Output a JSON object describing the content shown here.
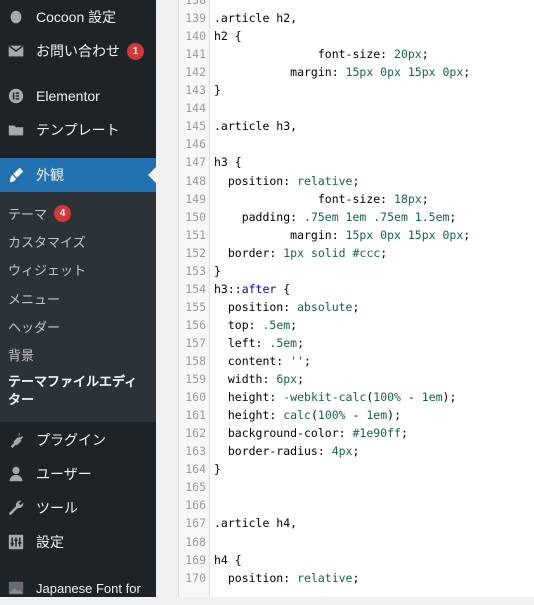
{
  "sidebar": {
    "items": [
      {
        "label": "Cocoon 設定",
        "icon": "circle-icon"
      },
      {
        "label": "お問い合わせ",
        "icon": "envelope-icon",
        "badge": "1"
      },
      {
        "label": "Elementor",
        "icon": "elementor-icon"
      },
      {
        "label": "テンプレート",
        "icon": "folder-icon"
      },
      {
        "label": "外観",
        "icon": "paintbrush-icon",
        "active": true
      },
      {
        "label": "プラグイン",
        "icon": "plugin-icon"
      },
      {
        "label": "ユーザー",
        "icon": "user-icon"
      },
      {
        "label": "ツール",
        "icon": "wrench-icon"
      },
      {
        "label": "設定",
        "icon": "settings-icon"
      },
      {
        "label": "Japanese Font for",
        "icon": "image-icon"
      }
    ],
    "submenu": [
      {
        "label": "テーマ",
        "badge": "4"
      },
      {
        "label": "カスタマイズ"
      },
      {
        "label": "ウィジェット"
      },
      {
        "label": "メニュー"
      },
      {
        "label": "ヘッダー"
      },
      {
        "label": "背景"
      },
      {
        "label": "テーマファイルエディター",
        "current": true
      }
    ],
    "active_color": "#2271b1",
    "badge_color": "#d63638"
  },
  "editor": {
    "lines": [
      {
        "n": "138",
        "tokens": []
      },
      {
        "n": "139",
        "tokens": [
          {
            "t": ".article h2,",
            "c": "sel"
          }
        ]
      },
      {
        "n": "140",
        "tokens": [
          {
            "t": "h2 {",
            "c": "sel"
          }
        ]
      },
      {
        "n": "141",
        "tokens": [
          {
            "t": "               font-size: ",
            "c": "prop"
          },
          {
            "t": "20px",
            "c": "num"
          },
          {
            "t": ";",
            "c": "prop"
          }
        ]
      },
      {
        "n": "142",
        "tokens": [
          {
            "t": "           margin: ",
            "c": "prop"
          },
          {
            "t": "15px 0px 15px 0px",
            "c": "num"
          },
          {
            "t": ";",
            "c": "prop"
          }
        ]
      },
      {
        "n": "143",
        "tokens": [
          {
            "t": "}",
            "c": "sel"
          }
        ]
      },
      {
        "n": "144",
        "tokens": []
      },
      {
        "n": "145",
        "tokens": [
          {
            "t": ".article h3,",
            "c": "sel"
          }
        ]
      },
      {
        "n": "146",
        "tokens": []
      },
      {
        "n": "147",
        "tokens": [
          {
            "t": "h3 {",
            "c": "sel"
          }
        ]
      },
      {
        "n": "148",
        "tokens": [
          {
            "t": "  position: ",
            "c": "prop"
          },
          {
            "t": "relative",
            "c": "val"
          },
          {
            "t": ";",
            "c": "prop"
          }
        ]
      },
      {
        "n": "149",
        "tokens": [
          {
            "t": "               font-size: ",
            "c": "prop"
          },
          {
            "t": "18px",
            "c": "num"
          },
          {
            "t": ";",
            "c": "prop"
          }
        ]
      },
      {
        "n": "150",
        "tokens": [
          {
            "t": "    padding: ",
            "c": "prop"
          },
          {
            "t": ".75em 1em .75em 1.5em",
            "c": "num"
          },
          {
            "t": ";",
            "c": "prop"
          }
        ]
      },
      {
        "n": "151",
        "tokens": [
          {
            "t": "           margin: ",
            "c": "prop"
          },
          {
            "t": "15px 0px 15px 0px",
            "c": "num"
          },
          {
            "t": ";",
            "c": "prop"
          }
        ]
      },
      {
        "n": "152",
        "tokens": [
          {
            "t": "  border: ",
            "c": "prop"
          },
          {
            "t": "1px solid #ccc",
            "c": "num"
          },
          {
            "t": ";",
            "c": "prop"
          }
        ]
      },
      {
        "n": "153",
        "tokens": [
          {
            "t": "}",
            "c": "sel"
          }
        ]
      },
      {
        "n": "154",
        "tokens": [
          {
            "t": "h3::",
            "c": "sel"
          },
          {
            "t": "after",
            "c": "kw"
          },
          {
            "t": " {",
            "c": "sel"
          }
        ]
      },
      {
        "n": "155",
        "tokens": [
          {
            "t": "  position: ",
            "c": "prop"
          },
          {
            "t": "absolute",
            "c": "val"
          },
          {
            "t": ";",
            "c": "prop"
          }
        ]
      },
      {
        "n": "156",
        "tokens": [
          {
            "t": "  top: ",
            "c": "prop"
          },
          {
            "t": ".5em",
            "c": "num"
          },
          {
            "t": ";",
            "c": "prop"
          }
        ]
      },
      {
        "n": "157",
        "tokens": [
          {
            "t": "  left: ",
            "c": "prop"
          },
          {
            "t": ".5em",
            "c": "num"
          },
          {
            "t": ";",
            "c": "prop"
          }
        ]
      },
      {
        "n": "158",
        "tokens": [
          {
            "t": "  content: ",
            "c": "prop"
          },
          {
            "t": "''",
            "c": "str"
          },
          {
            "t": ";",
            "c": "prop"
          }
        ]
      },
      {
        "n": "159",
        "tokens": [
          {
            "t": "  width: ",
            "c": "prop"
          },
          {
            "t": "6px",
            "c": "num"
          },
          {
            "t": ";",
            "c": "prop"
          }
        ]
      },
      {
        "n": "160",
        "tokens": [
          {
            "t": "  height: ",
            "c": "prop"
          },
          {
            "t": "-webkit-calc",
            "c": "val"
          },
          {
            "t": "(",
            "c": "prop"
          },
          {
            "t": "100%",
            "c": "num"
          },
          {
            "t": " - ",
            "c": "prop"
          },
          {
            "t": "1em",
            "c": "num"
          },
          {
            "t": ");",
            "c": "prop"
          }
        ]
      },
      {
        "n": "161",
        "tokens": [
          {
            "t": "  height: ",
            "c": "prop"
          },
          {
            "t": "calc",
            "c": "val"
          },
          {
            "t": "(",
            "c": "prop"
          },
          {
            "t": "100%",
            "c": "num"
          },
          {
            "t": " - ",
            "c": "prop"
          },
          {
            "t": "1em",
            "c": "num"
          },
          {
            "t": ");",
            "c": "prop"
          }
        ]
      },
      {
        "n": "162",
        "tokens": [
          {
            "t": "  background-color: ",
            "c": "prop"
          },
          {
            "t": "#1e90ff",
            "c": "num"
          },
          {
            "t": ";",
            "c": "prop"
          }
        ]
      },
      {
        "n": "163",
        "tokens": [
          {
            "t": "  border-radius: ",
            "c": "prop"
          },
          {
            "t": "4px",
            "c": "num"
          },
          {
            "t": ";",
            "c": "prop"
          }
        ]
      },
      {
        "n": "164",
        "tokens": [
          {
            "t": "}",
            "c": "sel"
          }
        ]
      },
      {
        "n": "165",
        "tokens": []
      },
      {
        "n": "166",
        "tokens": []
      },
      {
        "n": "167",
        "tokens": [
          {
            "t": ".article h4,",
            "c": "sel"
          }
        ]
      },
      {
        "n": "168",
        "tokens": []
      },
      {
        "n": "169",
        "tokens": [
          {
            "t": "h4 {",
            "c": "sel"
          }
        ]
      },
      {
        "n": "170",
        "tokens": [
          {
            "t": "  position: ",
            "c": "prop"
          },
          {
            "t": "relative",
            "c": "val"
          },
          {
            "t": ";",
            "c": "prop"
          }
        ]
      }
    ]
  }
}
